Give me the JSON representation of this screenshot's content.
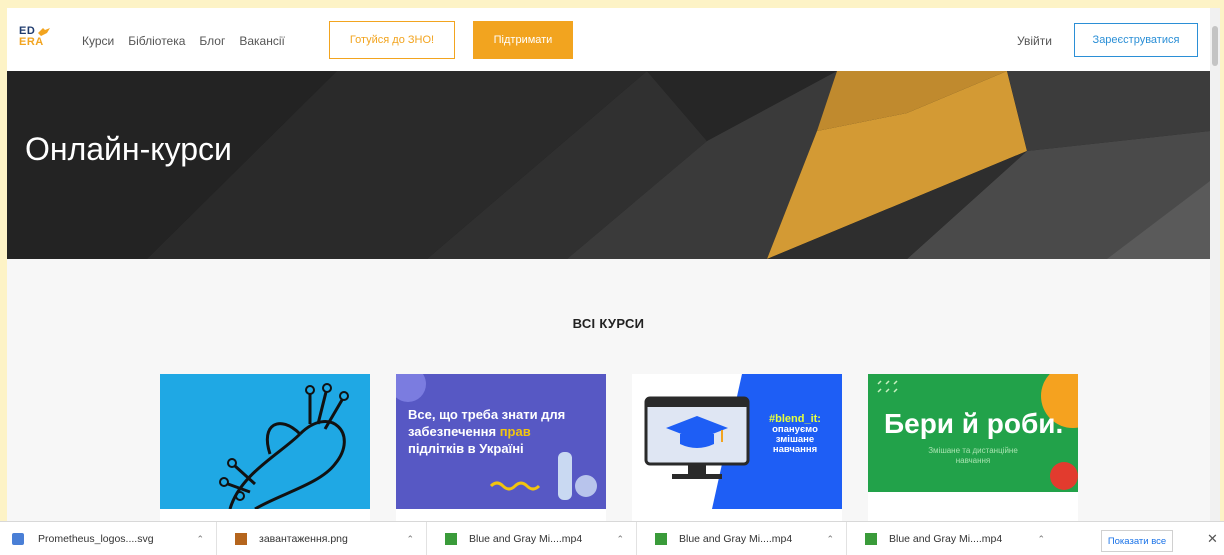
{
  "header": {
    "logo_top": "ED",
    "logo_bottom": "ERA",
    "nav": [
      "Курси",
      "Бібліотека",
      "Блог",
      "Вакансії"
    ],
    "zno_button": "Готуйся до ЗНО!",
    "support_button": "Підтримати",
    "login": "Увійти",
    "register_button": "Зареєструватися"
  },
  "hero": {
    "title": "Онлайн-курси"
  },
  "courses": {
    "section_title": "ВСІ КУРСИ",
    "card2": {
      "line1": "Все, що треба знати для",
      "line2a": "забезпечення ",
      "line2b": "прав",
      "line3": "підлітків в Україні"
    },
    "card3": {
      "hash": "#blend_it:",
      "line1": "опануємо",
      "line2": "змішане",
      "line3": "навчання"
    },
    "card4": {
      "big": "Бери й роби.",
      "small": "Змішане та дистанційне навчання"
    }
  },
  "downloads": {
    "items": [
      {
        "name": "Prometheus_logos....svg",
        "icon": "svg-file-icon"
      },
      {
        "name": "завантаження.png",
        "icon": "image-file-icon"
      },
      {
        "name": "Blue and Gray Mi....mp4",
        "icon": "video-file-icon"
      },
      {
        "name": "Blue and Gray Mi....mp4",
        "icon": "video-file-icon"
      },
      {
        "name": "Blue and Gray Mi....mp4",
        "icon": "video-file-icon"
      }
    ],
    "show_all": "Показати все",
    "close": "✕"
  },
  "colors": {
    "accent_orange": "#f2a41f",
    "link_blue": "#2b8fd6",
    "hero_dark": "#1d1d1d"
  }
}
